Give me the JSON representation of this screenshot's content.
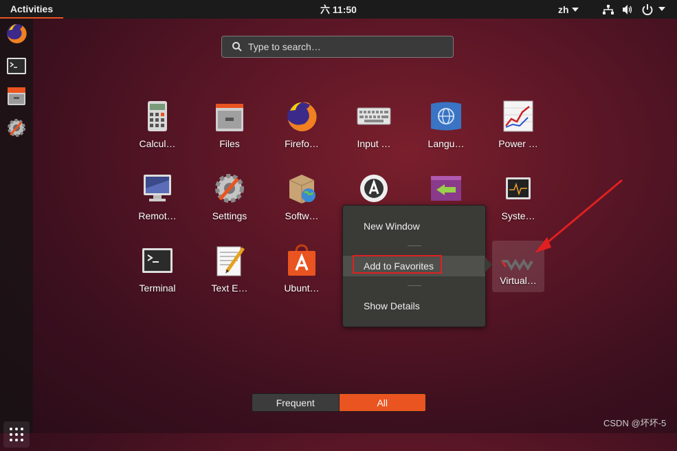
{
  "topbar": {
    "activities": "Activities",
    "clock": "六 11:50",
    "language": "zh"
  },
  "search": {
    "placeholder": "Type to search…"
  },
  "apps": [
    {
      "label": "Calcul…"
    },
    {
      "label": "Files"
    },
    {
      "label": "Firefo…"
    },
    {
      "label": "Input …"
    },
    {
      "label": "Langu…"
    },
    {
      "label": "Power …"
    },
    {
      "label": "Remot…"
    },
    {
      "label": "Settings"
    },
    {
      "label": "Softw…"
    },
    {
      "label": "Syste…"
    },
    {
      "label": "Terminal"
    },
    {
      "label": "Text E…"
    },
    {
      "label": "Ubunt…"
    },
    {
      "label": "Virtual…"
    }
  ],
  "context_menu": {
    "new_window": "New Window",
    "add_favorites": "Add to Favorites",
    "show_details": "Show Details"
  },
  "switcher": {
    "frequent": "Frequent",
    "all": "All"
  },
  "watermark": "CSDN @坏坏-5",
  "colors": {
    "accent": "#e95420",
    "highlight_box": "#e02020"
  }
}
